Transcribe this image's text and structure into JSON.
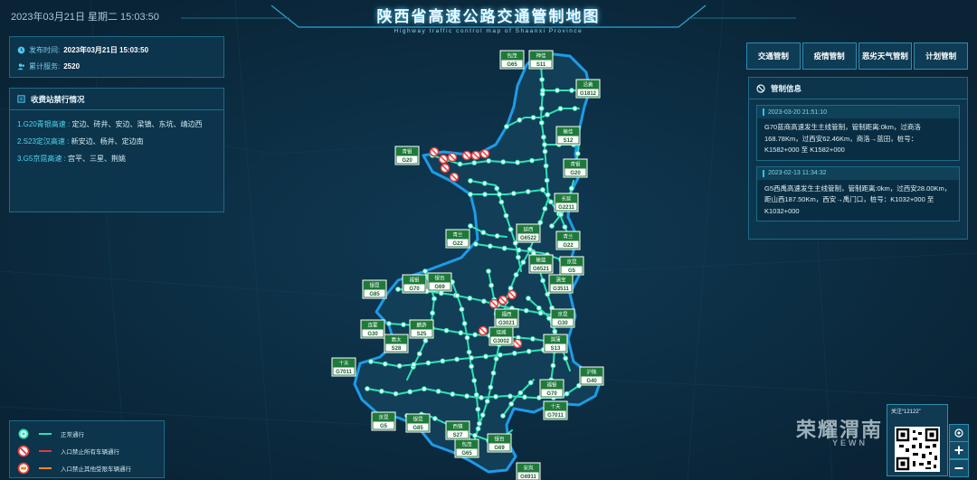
{
  "header": {
    "datetime": "2023年03月21日 星期二  15:03:50",
    "title": "陕西省高速公路交通管制地图",
    "subtitle": "Highway traffic control map of Shaanxi Province"
  },
  "info": {
    "publish_label": "发布时间:",
    "publish_value": "2023年03月21日  15:03:50",
    "service_label": "累计服务:",
    "service_value": "2520"
  },
  "toll": {
    "title": "收费站禁行情况",
    "items": [
      {
        "road": "1.G20青银高速 :",
        "text": "定边、砖井、安边、梁镇、东坑、靖边西"
      },
      {
        "road": "2.S23定汉高速 :",
        "text": "新安边、杨井、定边南"
      },
      {
        "road": "3.G5京昆高速 :",
        "text": "宫平、三星、荆姚"
      }
    ]
  },
  "tabs": [
    "交通管制",
    "疫情管制",
    "恶劣天气管制",
    "计划管制"
  ],
  "control": {
    "title": "管制信息",
    "items": [
      {
        "time": "2023-03-20 21:51:10",
        "text": "G70蓝商高速发生主线管制，管制距离:0km，过商洛168.78Km，过西安62.46Km，商洛→蓝田，桩号：K1582+000 至 K1582+000"
      },
      {
        "time": "2023-02-13 11:34:32",
        "text": "G5西禹高速发生主线管制，管制距离:0km，过西安28.00Km，距山西187.50Km，西安→禹门口，桩号：K1032+000 至 K1032+000"
      }
    ]
  },
  "legend": {
    "items": [
      "正常通行",
      "入口禁止所有车辆通行",
      "入口禁止其他受限车辆通行"
    ]
  },
  "colors": {
    "road_normal": "#2fe0b6",
    "province_border": "#1e9be8",
    "province_fill": "#123f57",
    "ban_all": "#e23b3b",
    "ban_restricted": "#f08a1e"
  },
  "watermark": {
    "follow": "关注“12122”",
    "brand": "荣耀渭南",
    "url": "YEWN"
  },
  "route_labels": [
    {
      "top": "神佳",
      "code": "S11"
    },
    {
      "top": "包茂",
      "code": "G65"
    },
    {
      "top": "沿黄",
      "code": "G1812"
    },
    {
      "top": "榆佳",
      "code": "S12"
    },
    {
      "top": "青银",
      "code": "G20"
    },
    {
      "top": "青银",
      "code": "G20"
    },
    {
      "top": "长延",
      "code": "G2211"
    },
    {
      "top": "延西",
      "code": "G6522"
    },
    {
      "top": "青兰",
      "code": "G22"
    },
    {
      "top": "青兰",
      "code": "G22"
    },
    {
      "top": "京昆",
      "code": "G5"
    },
    {
      "top": "榆蓝",
      "code": "G6521"
    },
    {
      "top": "蒲宝",
      "code": "G3511"
    },
    {
      "top": "银昆",
      "code": "G85"
    },
    {
      "top": "福银",
      "code": "G70"
    },
    {
      "top": "银百",
      "code": "G69"
    },
    {
      "top": "京昆",
      "code": "G30"
    },
    {
      "top": "福西",
      "code": "G3021"
    },
    {
      "top": "连霍",
      "code": "G30"
    },
    {
      "top": "麟游",
      "code": "S25"
    },
    {
      "top": "绕城",
      "code": "G3002"
    },
    {
      "top": "渭蒲",
      "code": "S13"
    },
    {
      "top": "眉太",
      "code": "S28"
    },
    {
      "top": "十天",
      "code": "G7011"
    },
    {
      "top": "沪陕",
      "code": "G40"
    },
    {
      "top": "福银",
      "code": "G70"
    },
    {
      "top": "十天",
      "code": "G7011"
    },
    {
      "top": "京昆",
      "code": "G5"
    },
    {
      "top": "银昆",
      "code": "G85"
    },
    {
      "top": "西镇",
      "code": "S27"
    },
    {
      "top": "银百",
      "code": "G69"
    },
    {
      "top": "包茂",
      "code": "G65"
    },
    {
      "top": "安岚",
      "code": "G6911"
    }
  ]
}
